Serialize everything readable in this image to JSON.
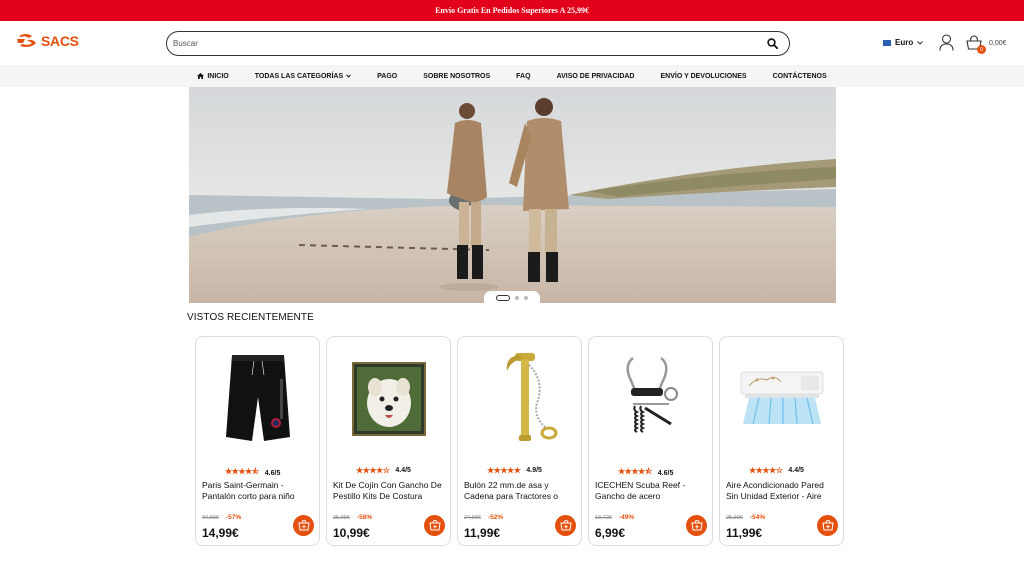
{
  "promo": {
    "text": "Envío Gratis En Pedidos Superiores A 25,99€"
  },
  "brand": {
    "name": "SACS",
    "accent": "#e4500e",
    "promo_bg": "#e3001b"
  },
  "search": {
    "placeholder": "Buscar",
    "value": ""
  },
  "currency": {
    "label": "Euro"
  },
  "cart": {
    "total": "0,00€",
    "count": "0"
  },
  "nav": {
    "items": [
      {
        "label": "INICIO",
        "icon": "home-icon"
      },
      {
        "label": "TODAS LAS CATEGORÍAS",
        "icon": "chevron-down-icon"
      },
      {
        "label": "PAGO"
      },
      {
        "label": "SOBRE NOSOTROS"
      },
      {
        "label": "FAQ"
      },
      {
        "label": "AVISO DE PRIVACIDAD"
      },
      {
        "label": "ENVÍO Y DEVOLUCIONES"
      },
      {
        "label": "CONTÁCTENOS"
      }
    ]
  },
  "carousel": {
    "slides": 3,
    "active": 1
  },
  "recent": {
    "title": "VISTOS RECIENTEMENTE",
    "products": [
      {
        "name": "Paris Saint-Germain - Pantalón corto para niño",
        "rating": "4.6/5",
        "stars": 4.5,
        "old_price": "34,99€",
        "discount": "-57%",
        "price": "14,99€",
        "image": "shorts"
      },
      {
        "name": "Kit De Cojín Con Gancho De Pestillo Kits De Costura",
        "rating": "4.4/5",
        "stars": 4,
        "old_price": "25,99€",
        "discount": "-58%",
        "price": "10,99€",
        "image": "pillow"
      },
      {
        "name": "Bulón 22 mm.de asa y Cadena para Tractores o",
        "rating": "4.9/5",
        "stars": 5,
        "old_price": "24,99€",
        "discount": "-52%",
        "price": "11,99€",
        "image": "pin"
      },
      {
        "name": "ICECHEN Scuba Reef - Gancho de acero",
        "rating": "4.6/5",
        "stars": 4.5,
        "old_price": "13,72€",
        "discount": "-49%",
        "price": "6,99€",
        "image": "hook"
      },
      {
        "name": "Aire Acondicionado Pared Sin Unidad Exterior - Aire",
        "rating": "4.4/5",
        "stars": 4,
        "old_price": "25,99€",
        "discount": "-54%",
        "price": "11,99€",
        "image": "aircon"
      }
    ]
  }
}
